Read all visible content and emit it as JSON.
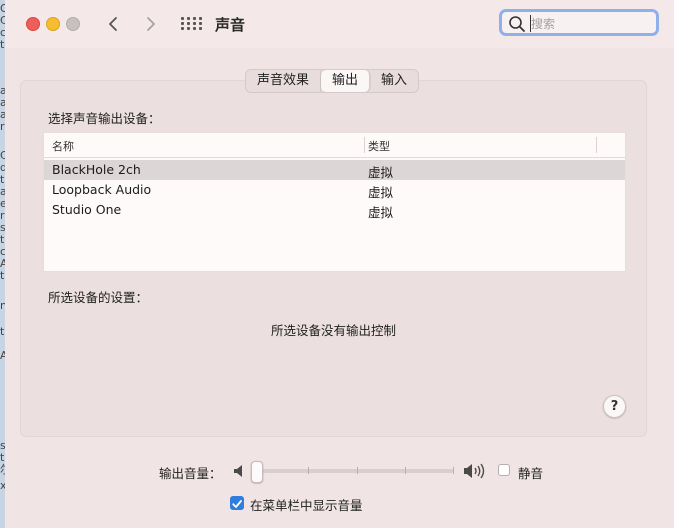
{
  "background_window": {
    "edge_glyphs": [
      "O",
      "C",
      "c",
      "t",
      "a",
      "a",
      "a",
      "r",
      "C",
      "d",
      "t",
      "a",
      "e",
      "r",
      "s",
      "t",
      "c",
      "A",
      "t",
      "n",
      "t",
      "A",
      "s",
      "t",
      "尔",
      "x"
    ]
  },
  "window": {
    "title": "声音",
    "nav": {
      "back_icon": "chevron-left-icon",
      "forward_icon": "chevron-right-icon",
      "grid_icon": "show-all-grid-icon"
    },
    "search": {
      "placeholder": "搜索",
      "value": "",
      "icon": "magnifier-icon"
    }
  },
  "tabs": [
    {
      "label": "声音效果",
      "active": false
    },
    {
      "label": "输出",
      "active": true
    },
    {
      "label": "输入",
      "active": false
    }
  ],
  "output": {
    "select_label": "选择声音输出设备：",
    "columns": [
      "名称",
      "类型"
    ],
    "devices": [
      {
        "name": "BlackHole 2ch",
        "type": "虚拟",
        "selected": true
      },
      {
        "name": "Loopback Audio",
        "type": "虚拟",
        "selected": false
      },
      {
        "name": "Studio One",
        "type": "虚拟",
        "selected": false
      }
    ],
    "settings_label": "所选设备的设置：",
    "no_controls_text": "所选设备没有输出控制",
    "help_label": "?"
  },
  "volume": {
    "label": "输出音量：",
    "level": 0.0,
    "mute_label": "静音",
    "muted": false,
    "show_in_menubar_label": "在菜单栏中显示音量",
    "show_in_menubar": true
  },
  "colors": {
    "window_bg": "#f0e4e4",
    "accent": "#2f7ddf",
    "close": "#ee5f59",
    "minimize": "#f5bd2f",
    "zoom_inactive": "#c8c0c0",
    "selected_row": "#dcd6d6"
  }
}
